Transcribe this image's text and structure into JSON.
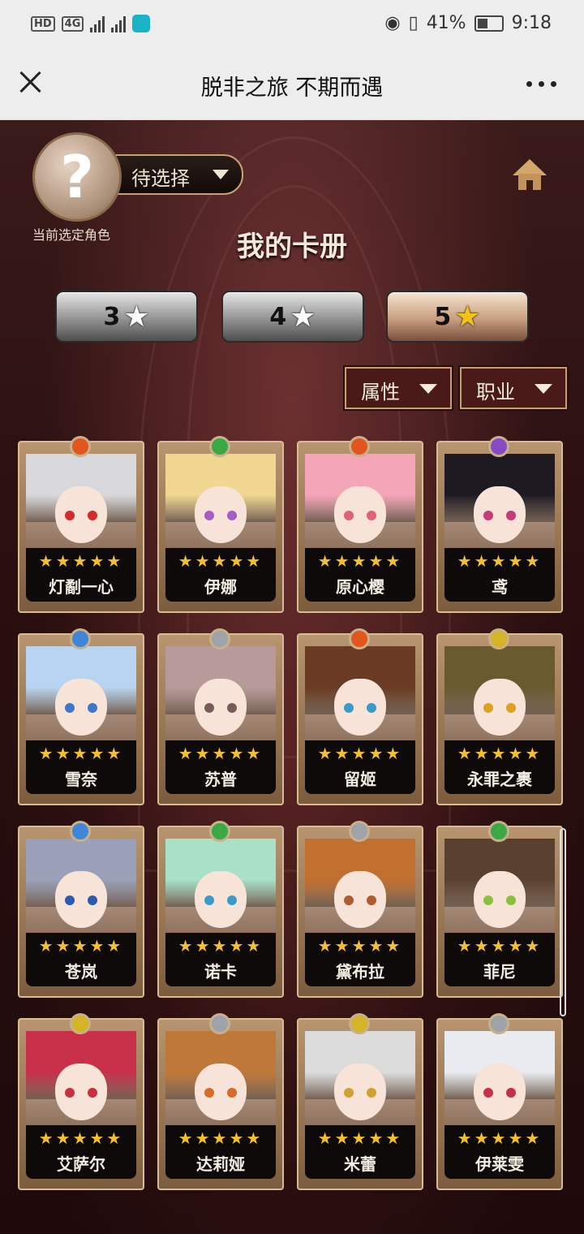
{
  "status_bar": {
    "left_chips": [
      "HD",
      "4G"
    ],
    "battery": "41%",
    "time": "9:18"
  },
  "titlebar": {
    "title": "脱非之旅 不期而遇"
  },
  "profile": {
    "avatar_symbol": "?",
    "select_label": "待选择",
    "caption": "当前选定角色"
  },
  "page_title": "我的卡册",
  "star_tabs": [
    {
      "label": "3",
      "active": false
    },
    {
      "label": "4",
      "active": false
    },
    {
      "label": "5",
      "active": true
    }
  ],
  "filters": {
    "attribute": "属性",
    "job": "职业"
  },
  "star_glyph": "★★★★★",
  "cards": [
    {
      "name": "灯劀一心",
      "gem": "#e2551d",
      "hair": "#d8d8dc",
      "eye": "#d42a2a"
    },
    {
      "name": "伊娜",
      "gem": "#3aa845",
      "hair": "#f0d690",
      "eye": "#a55cc4"
    },
    {
      "name": "原心樱",
      "gem": "#e2551d",
      "hair": "#f4a5b8",
      "eye": "#e0607a"
    },
    {
      "name": "鸢",
      "gem": "#8a4ac8",
      "hair": "#1e1a22",
      "eye": "#c43a7a"
    },
    {
      "name": "雪奈",
      "gem": "#3f86d8",
      "hair": "#b8d4f0",
      "eye": "#3d78c8"
    },
    {
      "name": "苏普",
      "gem": "#9ea3aa",
      "hair": "#b89a9a",
      "eye": "#7a5a5a"
    },
    {
      "name": "留姬",
      "gem": "#e2551d",
      "hair": "#6a3b22",
      "eye": "#3a9ac8"
    },
    {
      "name": "永罪之裹",
      "gem": "#d6b427",
      "hair": "#6a5a30",
      "eye": "#e0a020"
    },
    {
      "name": "苍岚",
      "gem": "#3f86d8",
      "hair": "#9aa0b8",
      "eye": "#2a5ab0"
    },
    {
      "name": "诺卡",
      "gem": "#3aa845",
      "hair": "#a8e0c8",
      "eye": "#3a9ac8"
    },
    {
      "name": "黛布拉",
      "gem": "#9ea3aa",
      "hair": "#c27030",
      "eye": "#b05a30"
    },
    {
      "name": "菲尼",
      "gem": "#3aa845",
      "hair": "#5a4030",
      "eye": "#8ac040"
    },
    {
      "name": "艾萨尔",
      "gem": "#d6b427",
      "hair": "#c8304a",
      "eye": "#c83040"
    },
    {
      "name": "达莉娅",
      "gem": "#9ea3aa",
      "hair": "#c07838",
      "eye": "#d86a2a"
    },
    {
      "name": "米蕾",
      "gem": "#d6b427",
      "hair": "#dcdcdc",
      "eye": "#d0a030"
    },
    {
      "name": "伊莱雯",
      "gem": "#9ea3aa",
      "hair": "#e8ecf0",
      "eye": "#c8304a"
    }
  ]
}
